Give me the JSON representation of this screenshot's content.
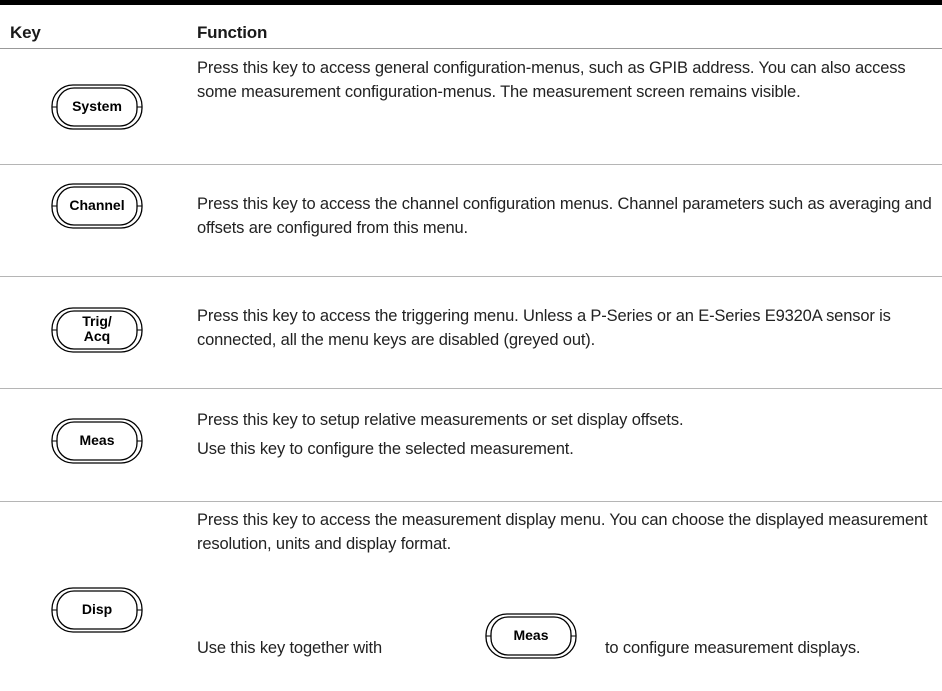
{
  "table": {
    "header": {
      "key": "Key",
      "function": "Function"
    },
    "rows": [
      {
        "key_label": "System",
        "description": [
          "Press this key to access general configuration-menus, such as GPIB address. You can also access some measurement configuration-menus. The measurement screen remains visible."
        ]
      },
      {
        "key_label": "Channel",
        "description": [
          "Press this key to access the channel configuration menus. Channel parameters such as averaging and offsets are configured from this menu."
        ]
      },
      {
        "key_label_line1": "Trig/",
        "key_label_line2": "Acq",
        "description": [
          "Press this key to access the triggering menu. Unless a P-Series or an E-Series E9320A sensor is connected, all the menu keys are disabled (greyed out)."
        ]
      },
      {
        "key_label": "Meas",
        "description": [
          "Press this key to setup relative measurements or set display offsets.",
          "Use this key to configure the selected measurement."
        ]
      },
      {
        "key_label": "Disp",
        "description": [
          "Press this key to access the measurement display menu. You can choose the displayed measurement resolution, units and display format."
        ],
        "inline_before": "Use this key together with",
        "inline_key_label": "Meas",
        "inline_after": "to configure measurement displays."
      }
    ]
  }
}
